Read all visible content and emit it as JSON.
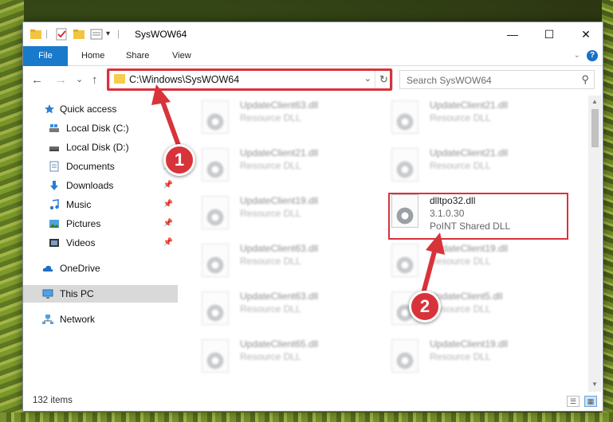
{
  "window": {
    "title": "SysWOW64",
    "minimize": "—",
    "maximize": "☐",
    "close": "✕"
  },
  "ribbon": {
    "tabs": [
      {
        "label": "File"
      },
      {
        "label": "Home"
      },
      {
        "label": "Share"
      },
      {
        "label": "View"
      }
    ],
    "help": "?"
  },
  "address_bar": {
    "path": "C:\\Windows\\SysWOW64",
    "back": "←",
    "forward": "→",
    "recent": "⌄",
    "up": "↑",
    "refresh": "↻"
  },
  "search": {
    "placeholder": "Search SysWOW64"
  },
  "sidebar": {
    "items": [
      {
        "label": "Quick access",
        "icon": "star-icon",
        "pinned": false
      },
      {
        "label": "Local Disk (C:)",
        "icon": "drive-icon",
        "pinned": false
      },
      {
        "label": "Local Disk (D:)",
        "icon": "drive-icon",
        "pinned": false
      },
      {
        "label": "Documents",
        "icon": "documents-icon",
        "pinned": true
      },
      {
        "label": "Downloads",
        "icon": "download-icon",
        "pinned": true
      },
      {
        "label": "Music",
        "icon": "music-icon",
        "pinned": true
      },
      {
        "label": "Pictures",
        "icon": "pictures-icon",
        "pinned": true
      },
      {
        "label": "Videos",
        "icon": "video-icon",
        "pinned": true
      },
      {
        "label": "OneDrive",
        "icon": "cloud-icon",
        "pinned": false
      },
      {
        "label": "This PC",
        "icon": "computer-icon",
        "pinned": false,
        "selected": true
      },
      {
        "label": "Network",
        "icon": "network-icon",
        "pinned": false
      }
    ]
  },
  "files": [
    {
      "name": "UpdateClient63.dll",
      "desc": "Resource DLL"
    },
    {
      "name": "UpdateClient21.dll",
      "desc": "Resource DLL"
    },
    {
      "name": "UpdateClient21.dll",
      "desc": "Resource DLL"
    },
    {
      "name": "UpdateClient21.dll",
      "desc": "Resource DLL"
    },
    {
      "name": "UpdateClient19.dll",
      "desc": "Resource DLL"
    },
    {
      "name": "dlltpo32.dll",
      "version": "3.1.0.30",
      "desc": "PoINT Shared DLL",
      "highlighted": true
    },
    {
      "name": "UpdateClient63.dll",
      "desc": "Resource DLL"
    },
    {
      "name": "UpdateClient19.dll",
      "desc": "Resource DLL"
    },
    {
      "name": "UpdateClient63.dll",
      "desc": "Resource DLL"
    },
    {
      "name": "UpdateClient5.dll",
      "desc": "Resource DLL"
    },
    {
      "name": "UpdateClient65.dll",
      "desc": "Resource DLL"
    },
    {
      "name": "UpdateClient19.dll",
      "desc": "Resource DLL"
    }
  ],
  "status": {
    "count": "132 items"
  },
  "annotations": {
    "step1": "1",
    "step2": "2",
    "color": "#d8333b"
  }
}
